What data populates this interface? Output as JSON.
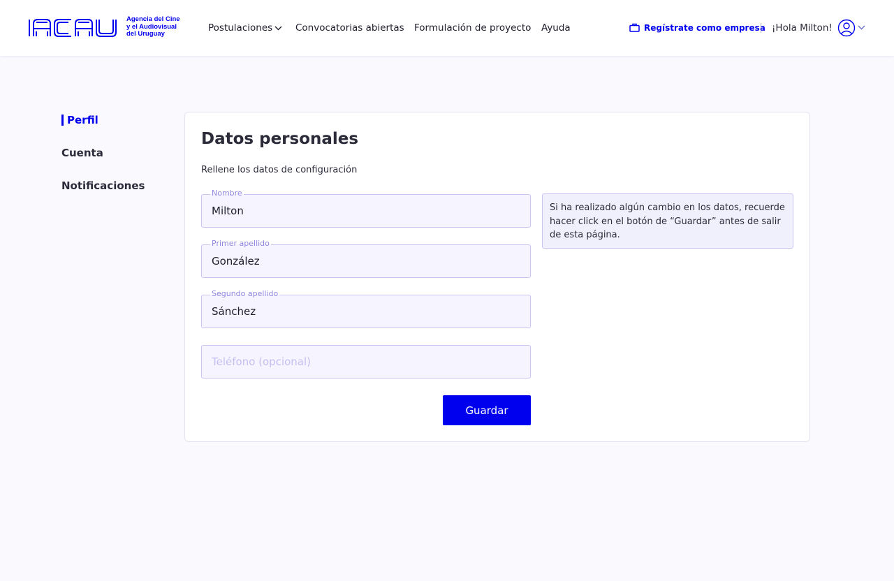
{
  "colors": {
    "accent": "#0000ee",
    "background": "#f9f9fe",
    "field_bg": "#f6f5ff",
    "field_border": "#c8c3f2",
    "label": "#8f86e0"
  },
  "logo": {
    "acronym": "ACAU",
    "lines": [
      "Agencia del Cine",
      "y el Audiovisual",
      "del Uruguay"
    ]
  },
  "nav": {
    "postulaciones": "Postulaciones",
    "convocatorias": "Convocatorias abiertas",
    "formulacion": "Formulación de proyecto",
    "ayuda": "Ayuda"
  },
  "header": {
    "company_link": "Regístrate como empresa",
    "greeting": "¡Hola Milton!",
    "icons": {
      "company": "briefcase-icon",
      "user": "user-circle-icon",
      "dropdown": "chevron-down-icon"
    }
  },
  "sidebar": {
    "items": [
      {
        "label": "Perfil",
        "active": true
      },
      {
        "label": "Cuenta",
        "active": false
      },
      {
        "label": "Notificaciones",
        "active": false
      }
    ]
  },
  "form": {
    "title": "Datos personales",
    "subtitle": "Rellene los datos de configuración",
    "nombre": {
      "label": "Nombre",
      "value": "Milton"
    },
    "primer_apellido": {
      "label": "Primer apellido",
      "value": "González"
    },
    "segundo_apellido": {
      "label": "Segundo apellido",
      "value": "Sánchez"
    },
    "telefono": {
      "placeholder": "Teléfono (opcional)",
      "value": ""
    },
    "notice": "Si ha realizado algún cambio en los datos, recuerde hacer click en el botón de “Guardar” antes de salir de esta página.",
    "save_label": "Guardar"
  }
}
